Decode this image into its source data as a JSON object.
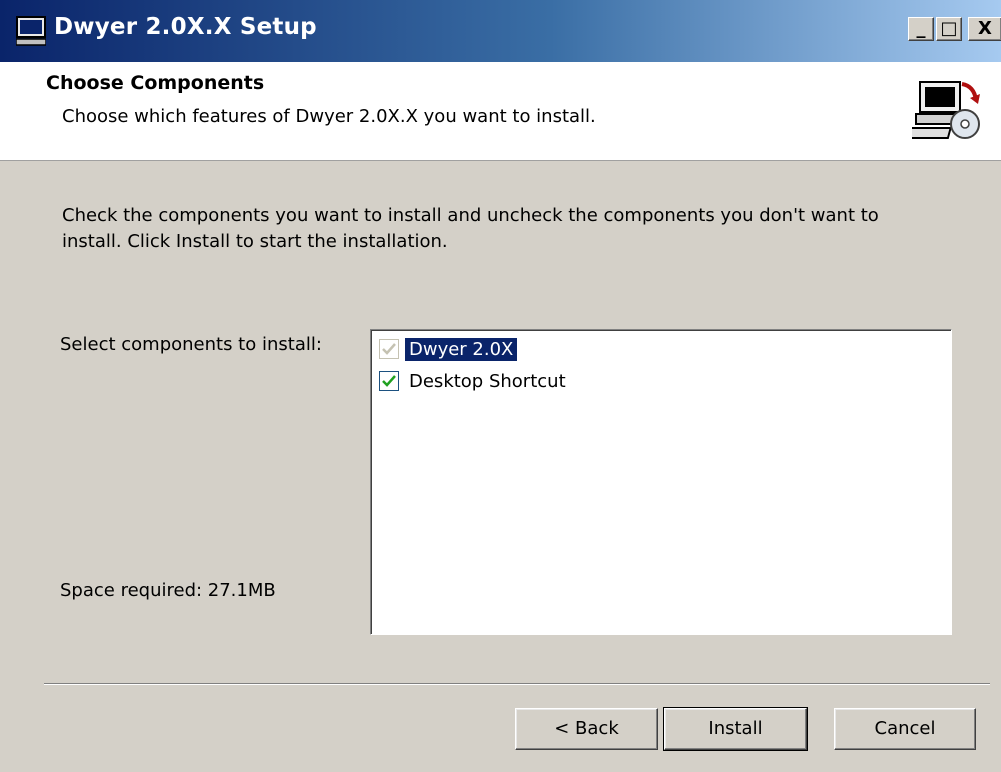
{
  "window": {
    "title": "Dwyer 2.0X.X Setup",
    "buttons": {
      "minimize": "_",
      "maximize": "□",
      "close": "X"
    }
  },
  "header": {
    "title": "Choose Components",
    "subtitle": "Choose which features of Dwyer 2.0X.X you want to install.",
    "icon": "computer-install-icon"
  },
  "body": {
    "intro": "Check the components you want to install and uncheck the components you don't want to install. Click Install to start the installation.",
    "select_label": "Select components to install:",
    "space_required": "Space required: 27.1MB"
  },
  "components": [
    {
      "label": "Dwyer 2.0X",
      "checked": true,
      "disabled": true,
      "selected": true
    },
    {
      "label": "Desktop Shortcut",
      "checked": true,
      "disabled": false,
      "selected": false
    }
  ],
  "buttons": {
    "back": "< Back",
    "install": "Install",
    "cancel": "Cancel"
  },
  "colors": {
    "titlebar_start": "#0a246a",
    "titlebar_end": "#a6caf0",
    "selection": "#0a246a",
    "dialog_bg": "#d4d0c8",
    "checkmark": "#21a121"
  }
}
